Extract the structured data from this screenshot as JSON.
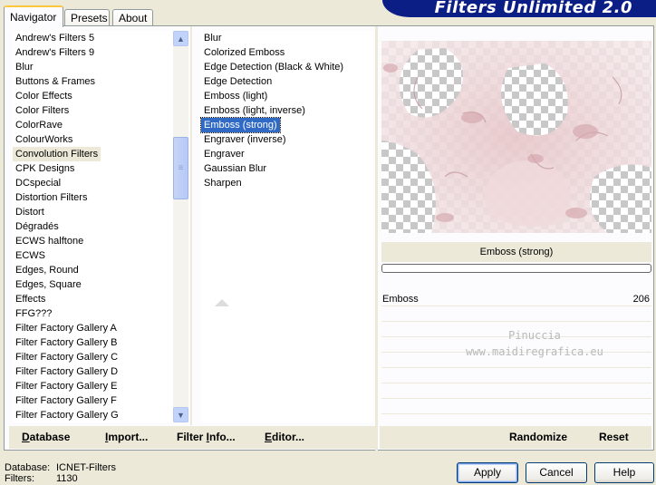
{
  "banner": {
    "title": "Filters Unlimited 2.0"
  },
  "tabs": [
    {
      "label": "Navigator",
      "active": true
    },
    {
      "label": "Presets",
      "active": false
    },
    {
      "label": "About",
      "active": false
    }
  ],
  "categories": {
    "items": [
      "Andrew's Filters 5",
      "Andrew's Filters 9",
      "Blur",
      "Buttons & Frames",
      "Color Effects",
      "Color Filters",
      "ColorRave",
      "ColourWorks",
      "Convolution Filters",
      "CPK Designs",
      "DCspecial",
      "Distortion Filters",
      "Distort",
      "Dégradés",
      "ECWS halftone",
      "ECWS",
      "Edges, Round",
      "Edges, Square",
      "Effects",
      "FFG???",
      "Filter Factory Gallery A",
      "Filter Factory Gallery B",
      "Filter Factory Gallery C",
      "Filter Factory Gallery D",
      "Filter Factory Gallery E",
      "Filter Factory Gallery F",
      "Filter Factory Gallery G"
    ],
    "selected_index": 8
  },
  "filters": {
    "items": [
      "Blur",
      "Colorized Emboss",
      "Edge Detection (Black & White)",
      "Edge Detection",
      "Emboss (light)",
      "Emboss (light, inverse)",
      "Emboss (strong)",
      "Engraver (inverse)",
      "Engraver",
      "Gaussian Blur",
      "Sharpen"
    ],
    "selected_index": 6
  },
  "preview": {
    "current_filter": "Emboss (strong)",
    "progress": 0
  },
  "parameters": [
    {
      "name": "Emboss",
      "value": "206"
    }
  ],
  "watermark": {
    "line1": "Pinuccia",
    "line2": "www.maidiregrafica.eu"
  },
  "links": {
    "database": {
      "u": "D",
      "rest": "atabase"
    },
    "import": {
      "u": "I",
      "rest": "mport..."
    },
    "filter_info": {
      "pre": "Filter ",
      "u": "I",
      "rest": "nfo..."
    },
    "editor": {
      "u": "E",
      "rest": "ditor..."
    },
    "randomize": "Randomize",
    "reset": "Reset"
  },
  "status": {
    "database_label": "Database:",
    "database_value": "ICNET-Filters",
    "filters_label": "Filters:",
    "filters_value": "1130"
  },
  "buttons": {
    "apply": "Apply",
    "cancel": "Cancel",
    "help": "Help"
  },
  "colors": {
    "banner": "#0a1e86",
    "selection": "#316ac5",
    "window": "#ece9d8"
  }
}
